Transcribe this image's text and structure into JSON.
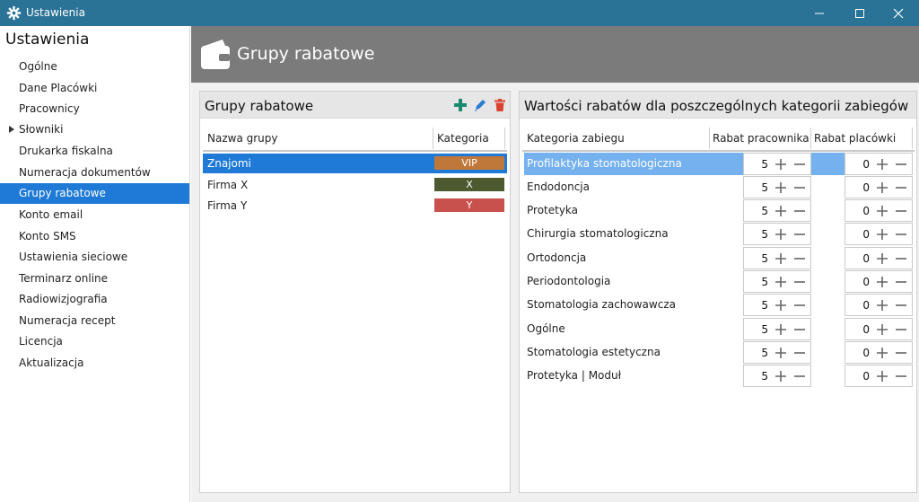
{
  "window": {
    "title": "Ustawienia"
  },
  "sidebar": {
    "heading": "Ustawienia",
    "items": [
      {
        "label": "Ogólne"
      },
      {
        "label": "Dane Placówki"
      },
      {
        "label": "Pracownicy"
      },
      {
        "label": "Słowniki"
      },
      {
        "label": "Drukarka fiskalna"
      },
      {
        "label": "Numeracja dokumentów"
      },
      {
        "label": "Grupy rabatowe"
      },
      {
        "label": "Konto email"
      },
      {
        "label": "Konto SMS"
      },
      {
        "label": "Ustawienia sieciowe"
      },
      {
        "label": "Terminarz online"
      },
      {
        "label": "Radiowizjografia"
      },
      {
        "label": "Numeracja recept"
      },
      {
        "label": "Licencja"
      },
      {
        "label": "Aktualizacja"
      }
    ]
  },
  "banner": {
    "title": "Grupy rabatowe"
  },
  "groups_panel": {
    "title": "Grupy rabatowe",
    "columns": {
      "name": "Nazwa grupy",
      "category": "Kategoria"
    },
    "rows": [
      {
        "name": "Znajomi",
        "category": "VIP",
        "color": "#c0783a"
      },
      {
        "name": "Firma X",
        "category": "X",
        "color": "#4d5a30"
      },
      {
        "name": "Firma Y",
        "category": "Y",
        "color": "#c8504d"
      }
    ]
  },
  "values_panel": {
    "title": "Wartości rabatów dla poszczególnych kategorii zabiegów",
    "columns": {
      "category": "Kategoria zabiegu",
      "employee": "Rabat pracownika",
      "clinic": "Rabat placówki"
    },
    "rows": [
      {
        "name": "Profilaktyka stomatologiczna",
        "employee": "5",
        "clinic": "0"
      },
      {
        "name": "Endodoncja",
        "employee": "5",
        "clinic": "0"
      },
      {
        "name": "Protetyka",
        "employee": "5",
        "clinic": "0"
      },
      {
        "name": "Chirurgia stomatologiczna",
        "employee": "5",
        "clinic": "0"
      },
      {
        "name": "Ortodoncja",
        "employee": "5",
        "clinic": "0"
      },
      {
        "name": "Periodontologia",
        "employee": "5",
        "clinic": "0"
      },
      {
        "name": "Stomatologia zachowawcza",
        "employee": "5",
        "clinic": "0"
      },
      {
        "name": "Ogólne",
        "employee": "5",
        "clinic": "0"
      },
      {
        "name": "Stomatologia estetyczna",
        "employee": "5",
        "clinic": "0"
      },
      {
        "name": "Protetyka | Moduł",
        "employee": "5",
        "clinic": "0"
      }
    ]
  },
  "icons": {
    "app": "gear-icon",
    "minimize": "minimize-icon",
    "maximize": "maximize-icon",
    "close": "close-icon",
    "banner": "wallet-icon",
    "add": "plus-icon",
    "edit": "pencil-icon",
    "delete": "trash-icon"
  },
  "colors": {
    "titlebar": "#2b7396",
    "selection": "#1e7ad6",
    "selection_light": "#74b1ee",
    "banner": "#7b7b7b",
    "add": "#1a8a6e",
    "edit": "#2b7bd1",
    "delete": "#d9432f"
  }
}
